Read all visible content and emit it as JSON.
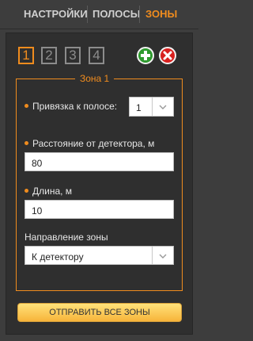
{
  "tabs": {
    "settings": "НАСТРОЙКИ",
    "lanes": "ПОЛОСЫ",
    "zones": "ЗОНЫ"
  },
  "zone_selector": [
    "1",
    "2",
    "3",
    "4"
  ],
  "zone_panel": {
    "title": "Зона 1",
    "lane_binding_label": "Привязка к полосе:",
    "lane_binding_value": "1",
    "distance_label": "Расстояние от детектора, м",
    "distance_value": "80",
    "length_label": "Длина, м",
    "length_value": "10",
    "direction_label": "Направление зоны",
    "direction_value": "К детектору"
  },
  "actions": {
    "add_icon": "plus-icon",
    "delete_icon": "close-icon",
    "send_all": "ОТПРАВИТЬ ВСЕ ЗОНЫ"
  },
  "colors": {
    "accent": "#f08c1e",
    "add": "#2e9a2e",
    "delete": "#d8201e"
  }
}
